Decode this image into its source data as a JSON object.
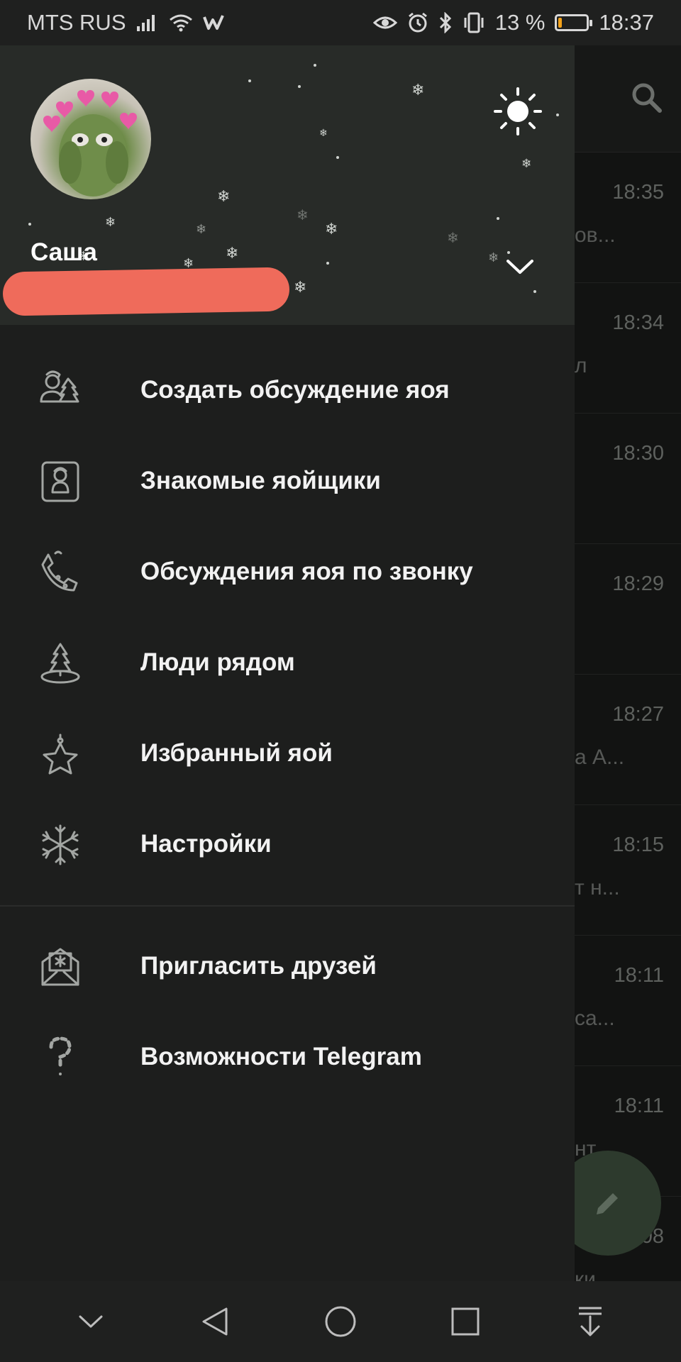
{
  "status_bar": {
    "carrier": "MTS RUS",
    "battery_percent": "13 %",
    "battery_level": 0.13,
    "battery_color": "#f3a21a",
    "time": "18:37",
    "icons": [
      "signal-icon",
      "wifi-icon",
      "app-w-icon",
      "eye-icon",
      "alarm-icon",
      "bluetooth-icon",
      "vibrate-icon",
      "battery-icon"
    ]
  },
  "drawer": {
    "profile": {
      "name": "Саша",
      "avatar_icon": "avatar-kermit"
    },
    "header_icons": {
      "theme": "sun-icon",
      "expand": "chevron-down-icon"
    },
    "menu": [
      {
        "label": "Создать обсуждение яоя",
        "icon": "group-icon"
      },
      {
        "label": "Знакомые яойщики",
        "icon": "contacts-icon"
      },
      {
        "label": "Обсуждения яоя по звонку",
        "icon": "phone-icon"
      },
      {
        "label": "Люди рядом",
        "icon": "people-nearby-icon"
      },
      {
        "label": "Избранный яой",
        "icon": "saved-star-icon"
      },
      {
        "label": "Настройки",
        "icon": "settings-snowflake-icon"
      }
    ],
    "secondary_menu": [
      {
        "label": "Пригласить друзей",
        "icon": "invite-envelope-icon"
      },
      {
        "label": "Возможности Telegram",
        "icon": "question-icon"
      }
    ]
  },
  "chat_list": {
    "header_icon": "search-icon",
    "rows": [
      {
        "time": "18:35",
        "snippet": "ов..."
      },
      {
        "time": "18:34",
        "snippet": "л"
      },
      {
        "time": "18:30",
        "snippet": ""
      },
      {
        "time": "18:29",
        "snippet": ""
      },
      {
        "time": "18:27",
        "snippet": "а А..."
      },
      {
        "time": "18:15",
        "snippet": "т н..."
      },
      {
        "time": "18:11",
        "snippet": "са..."
      },
      {
        "time": "18:11",
        "snippet": "нт"
      },
      {
        "time": "08",
        "snippet": "ки"
      }
    ],
    "fab_icon": "pencil-icon"
  },
  "nav_bar": {
    "buttons": [
      "hide-nav-icon",
      "back-icon",
      "home-icon",
      "recents-icon",
      "notifications-pull-icon"
    ]
  }
}
